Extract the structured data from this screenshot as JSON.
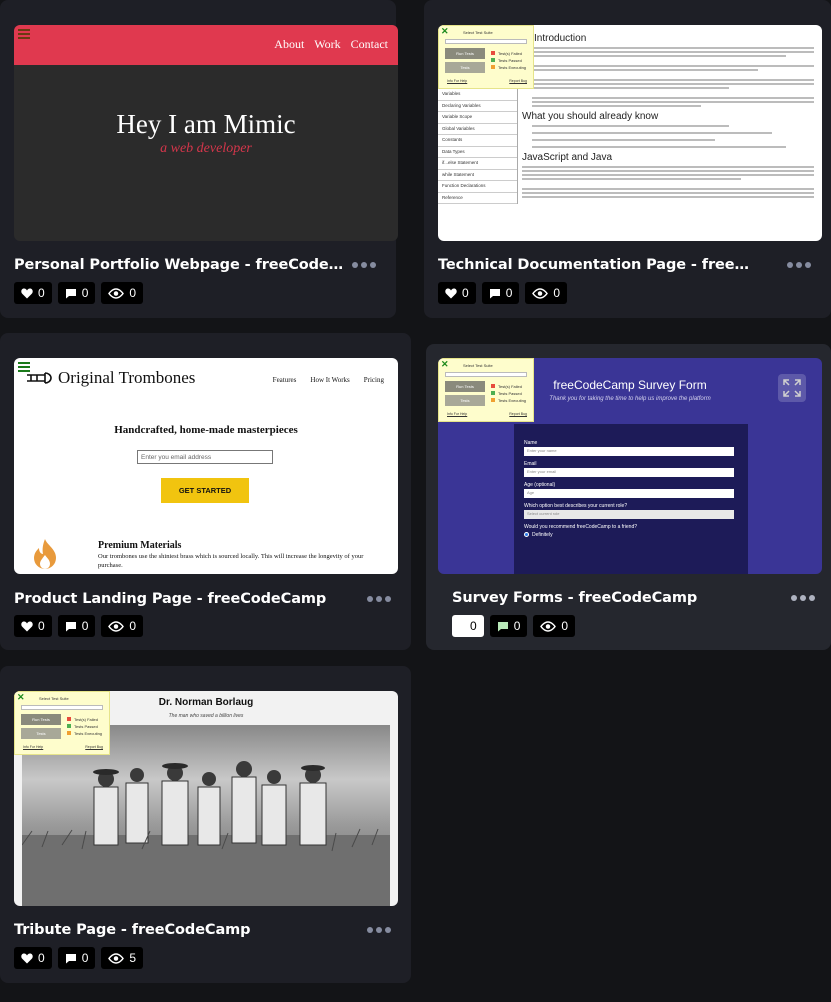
{
  "cards": [
    {
      "title": "Personal Portfolio Webpage - freeCodeCamp",
      "likes": "0",
      "comments": "0",
      "views": "0",
      "preview": {
        "nav_links": [
          "About",
          "Work",
          "Contact"
        ],
        "heading": "Hey I am Mimic",
        "subheading": "a web developer"
      }
    },
    {
      "title": "Technical Documentation Page - freeCodeCamp",
      "likes": "0",
      "comments": "0",
      "views": "0",
      "preview": {
        "heading": "Introduction",
        "section_1": "What you should already know",
        "section_2": "JavaScript and Java",
        "sidebar": [
          "Variables",
          "Declaring Variables",
          "Variable Scope",
          "Global Variables",
          "Constants",
          "Data Types",
          "if...else Statement",
          "while Statement",
          "Function Declarations",
          "Reference"
        ]
      }
    },
    {
      "title": "Product Landing Page - freeCodeCamp",
      "likes": "0",
      "comments": "0",
      "views": "0",
      "preview": {
        "brand": "Original Trombones",
        "nav_links": [
          "Features",
          "How It Works",
          "Pricing"
        ],
        "heading": "Handcrafted, home-made masterpieces",
        "email_placeholder": "Enter you email address",
        "cta": "GET STARTED",
        "feature_title": "Premium Materials",
        "feature_text": "Our trombones use the shiniest brass which is sourced locally. This will increase the longevity of your purchase."
      }
    },
    {
      "title": "Survey Forms - freeCodeCamp",
      "likes": "0",
      "comments": "0",
      "views": "0",
      "preview": {
        "heading": "freeCodeCamp Survey Form",
        "subheading": "Thank you for taking the time to help us improve the platform",
        "fields": [
          {
            "label": "Name",
            "placeholder": "Enter your name"
          },
          {
            "label": "Email",
            "placeholder": "Enter your email"
          },
          {
            "label": "Age (optional)",
            "placeholder": "Age"
          },
          {
            "label": "Which option best describes your current role?",
            "placeholder": "Select current role"
          }
        ],
        "question": "Would you recommend freeCodeCamp to a friend?",
        "option": "Definitely"
      }
    },
    {
      "title": "Tribute Page - freeCodeCamp",
      "likes": "0",
      "comments": "0",
      "views": "5",
      "preview": {
        "heading": "Dr. Norman Borlaug",
        "subheading": "The man who saved a billion lives"
      }
    }
  ],
  "test_suite": {
    "title": "Select Test Suite",
    "run_button": "Run Tests",
    "tests_button": "Tests",
    "legend": [
      "Test(s) Failed",
      "Tests Passed",
      "Tests Executing"
    ],
    "footer_left": "Info For Help",
    "footer_right": "Report Bug"
  },
  "colors": {
    "page_bg": "#131417",
    "card_bg": "#1e1f26",
    "portfolio_nav": "#e0394f",
    "survey_bg": "#3a3596",
    "cta_yellow": "#f1c40f"
  }
}
